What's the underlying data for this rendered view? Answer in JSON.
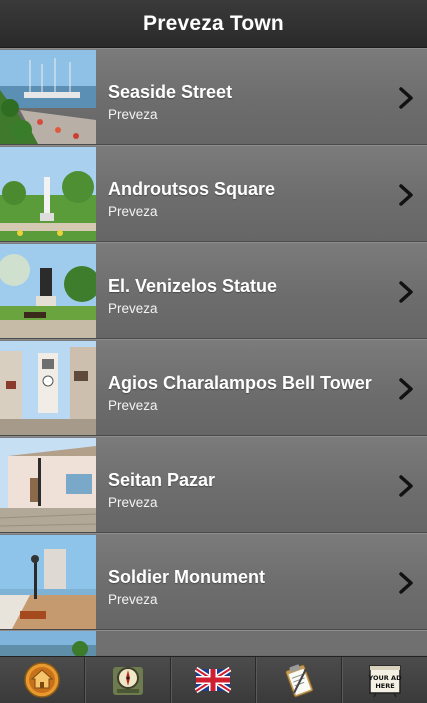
{
  "header": {
    "title": "Preveza Town"
  },
  "list": {
    "items": [
      {
        "title": "Seaside Street",
        "subtitle": "Preveza"
      },
      {
        "title": "Androutsos Square",
        "subtitle": "Preveza"
      },
      {
        "title": "El. Venizelos Statue",
        "subtitle": "Preveza"
      },
      {
        "title": "Agios Charalampos Bell Tower",
        "subtitle": "Preveza"
      },
      {
        "title": "Seitan Pazar",
        "subtitle": "Preveza"
      },
      {
        "title": "Soldier Monument",
        "subtitle": "Preveza"
      }
    ]
  },
  "tabbar": {
    "tabs": [
      {
        "icon": "home-icon"
      },
      {
        "icon": "compass-icon"
      },
      {
        "icon": "uk-flag-icon"
      },
      {
        "icon": "clipboard-icon"
      },
      {
        "icon": "ad-icon",
        "label": "YOUR AD HERE"
      }
    ]
  }
}
